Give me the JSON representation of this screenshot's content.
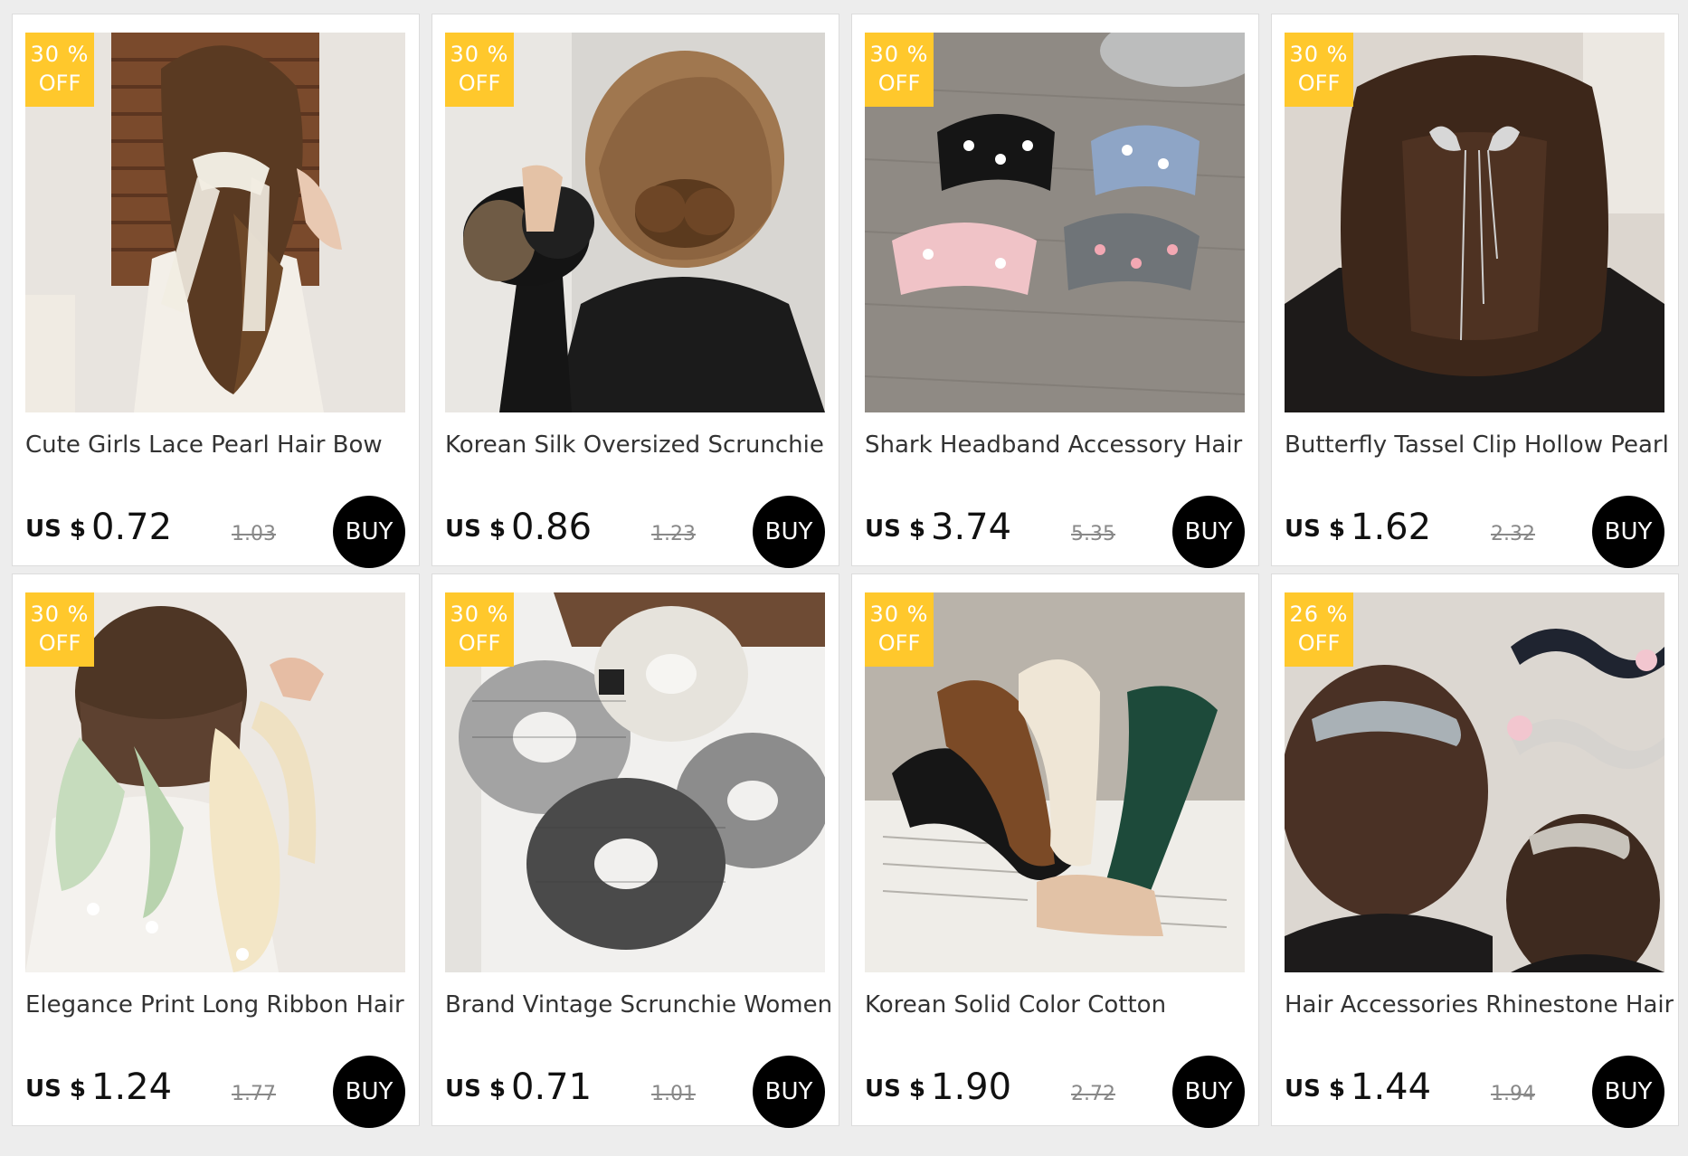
{
  "colors": {
    "background": "#ededed",
    "badge": "#ffc82c",
    "buy_button": "#000000"
  },
  "products": [
    {
      "discount": "30 %",
      "off": "OFF",
      "title": "Cute Girls Lace Pearl Hair Bow",
      "currency": "US $",
      "price": "0.72",
      "old_price": "1.03",
      "buy": "BUY",
      "image": "lace-pearl-hair-bow-photo"
    },
    {
      "discount": "30 %",
      "off": "OFF",
      "title": "Korean Silk Oversized Scrunchie",
      "currency": "US $",
      "price": "0.86",
      "old_price": "1.23",
      "buy": "BUY",
      "image": "silk-scrunchie-photo"
    },
    {
      "discount": "30 %",
      "off": "OFF",
      "title": "Shark Headband Accessory Hair",
      "currency": "US $",
      "price": "3.74",
      "old_price": "5.35",
      "buy": "BUY",
      "image": "shark-claw-clips-photo"
    },
    {
      "discount": "30 %",
      "off": "OFF",
      "title": "Butterfly Tassel Clip Hollow Pearl",
      "currency": "US $",
      "price": "1.62",
      "old_price": "2.32",
      "buy": "BUY",
      "image": "butterfly-tassel-clip-photo"
    },
    {
      "discount": "30 %",
      "off": "OFF",
      "title": "Elegance Print Long Ribbon Hair",
      "currency": "US $",
      "price": "1.24",
      "old_price": "1.77",
      "buy": "BUY",
      "image": "ribbon-scrunchie-photo"
    },
    {
      "discount": "30 %",
      "off": "OFF",
      "title": "Brand Vintage Scrunchie Women",
      "currency": "US $",
      "price": "0.71",
      "old_price": "1.01",
      "buy": "BUY",
      "image": "plaid-scrunchies-photo"
    },
    {
      "discount": "30 %",
      "off": "OFF",
      "title": "Korean Solid Color Cotton",
      "currency": "US $",
      "price": "1.90",
      "old_price": "2.72",
      "buy": "BUY",
      "image": "solid-headbands-photo"
    },
    {
      "discount": "26 %",
      "off": "OFF",
      "title": "Hair Accessories Rhinestone Hair",
      "currency": "US $",
      "price": "1.44",
      "old_price": "1.94",
      "buy": "BUY",
      "image": "rhinestone-hair-clip-photo"
    }
  ]
}
